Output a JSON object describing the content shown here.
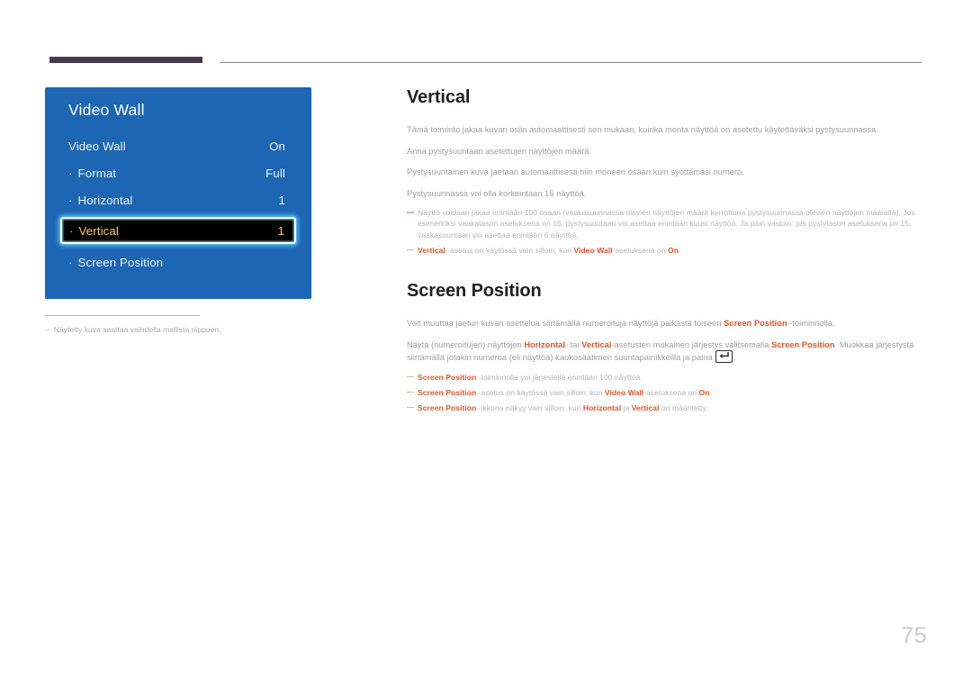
{
  "colors": {
    "osd_panel_blue": "#1c66b4",
    "accent_orange": "#e0552a",
    "selected_text_gold": "#ffd24a",
    "rule_purple": "#463a53",
    "body_gray": "#9d9ea1"
  },
  "osd": {
    "title": "Video Wall",
    "rows": [
      {
        "label": "Video Wall",
        "value": "On",
        "sub": false,
        "selected": false
      },
      {
        "label": "Format",
        "value": "Full",
        "sub": true,
        "selected": false
      },
      {
        "label": "Horizontal",
        "value": "1",
        "sub": true,
        "selected": false
      },
      {
        "label": "Vertical",
        "value": "1",
        "sub": true,
        "selected": true
      },
      {
        "label": "Screen Position",
        "value": "",
        "sub": true,
        "selected": false
      }
    ]
  },
  "figure_note": {
    "dash": "–",
    "text": "Näytetty kuva saattaa vaihdella mallista riippuen."
  },
  "sections": [
    {
      "title": "Vertical",
      "paragraphs": [
        "Tämä toiminto jakaa kuvan osiin automaattisesti sen mukaan, kuinka monta näyttöä on asetettu käytettäväksi pystysuunnassa.",
        "Anna pystysuuntaan asetettujen näyttöjen määrä.",
        "Pystysuuntainen kuva jaetaan automaattisesti niin moneen osaan kuin syöttämäsi numero.",
        "Pystysuunnassa voi olla korkeintaan 15 näyttöä."
      ],
      "notes": [
        {
          "parts": [
            {
              "t": "Näyttö voidaan jakaa enintään 100 osaan (vaakasuunnassa olevien näyttöjen määrä kerrottuna pystysuunnassa olevien näyttöjen määrällä). Jos esimerkiksi vaakatason asetuksena on 15, pystysuuntaan voi asettaa enintään kuusi näyttöä. Ja päin vastoin: jos pystytason asetuksena on 15, vaakasuuntaan voi asettaa enintään 6 näyttöä.",
              "s": "plain"
            }
          ]
        },
        {
          "parts": [
            {
              "t": "Vertical",
              "s": "accent"
            },
            {
              "t": " -asetus on käytössä vain silloin, kun ",
              "s": "plain"
            },
            {
              "t": "Video Wall",
              "s": "accent"
            },
            {
              "t": "-asetuksena on ",
              "s": "plain"
            },
            {
              "t": "On",
              "s": "accent"
            },
            {
              "t": ".",
              "s": "plain"
            }
          ]
        }
      ]
    },
    {
      "title": "Screen Position",
      "paragraphs_rich": [
        [
          {
            "t": "Voit muuttaa jaetun kuvan asettelua siirtämällä numeroituja näyttöjä paikasta toiseen ",
            "s": "plain"
          },
          {
            "t": "Screen Position",
            "s": "accent"
          },
          {
            "t": " -toiminnolla.",
            "s": "plain"
          }
        ],
        [
          {
            "t": "Näytä (numeroitujen) näyttöjen ",
            "s": "plain"
          },
          {
            "t": "Horizontal",
            "s": "accent"
          },
          {
            "t": "- tai ",
            "s": "plain"
          },
          {
            "t": "Vertical",
            "s": "accent"
          },
          {
            "t": "-asetusten mukainen järjestys valitsemalla ",
            "s": "plain"
          },
          {
            "t": "Screen Position",
            "s": "accent"
          },
          {
            "t": ". Muokkaa järjestystä siirtämällä jotakin numeroa (eli näyttöä) kaukosäätimen suuntapainikkeilla ja paina ",
            "s": "plain"
          },
          {
            "t": "",
            "s": "enter-key"
          },
          {
            "t": ".",
            "s": "plain"
          }
        ]
      ],
      "notes": [
        {
          "parts": [
            {
              "t": "Screen Position",
              "s": "accent"
            },
            {
              "t": " -toiminnolla voi järjestellä enintään 100 näyttöä.",
              "s": "plain"
            }
          ]
        },
        {
          "parts": [
            {
              "t": "Screen Position",
              "s": "accent"
            },
            {
              "t": " -asetus on käytössä vain silloin, kun ",
              "s": "plain"
            },
            {
              "t": "Video Wall",
              "s": "accent"
            },
            {
              "t": "-asetuksena on ",
              "s": "plain"
            },
            {
              "t": "On",
              "s": "accent"
            },
            {
              "t": ".",
              "s": "plain"
            }
          ]
        },
        {
          "parts": [
            {
              "t": "Screen Position",
              "s": "accent"
            },
            {
              "t": " -ikkuna näkyy vain silloin, kun ",
              "s": "plain"
            },
            {
              "t": "Horizontal",
              "s": "accent"
            },
            {
              "t": " ja ",
              "s": "plain"
            },
            {
              "t": "Vertical",
              "s": "accent"
            },
            {
              "t": " on määritetty.",
              "s": "plain"
            }
          ]
        }
      ]
    }
  ],
  "page_number": "75"
}
